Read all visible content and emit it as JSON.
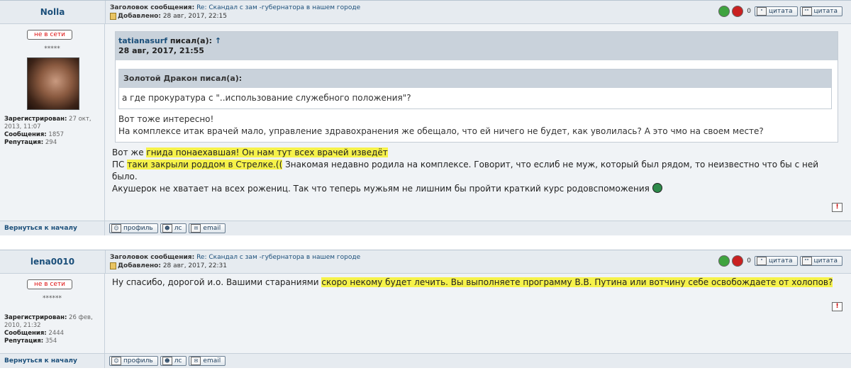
{
  "labels": {
    "subject": "Заголовок сообщения:",
    "added": "Добавлено:",
    "offline": "не в сети",
    "registered": "Зарегистрирован:",
    "messages": "Сообщения:",
    "reputation": "Репутация:",
    "quote_btn": "цитата",
    "profile_btn": "профиль",
    "pm_btn": "лс",
    "email_btn": "email",
    "back_top": "Вернуться к началу",
    "vote_count": "0",
    "report": "!"
  },
  "posts": [
    {
      "author": "Nolla",
      "stars": "*****",
      "subject": "Re: Скандал с зам -губернатора в нашем городе",
      "date": "28 авг, 2017, 22:15",
      "registered": "27 окт, 2013, 11:07",
      "messages": "1857",
      "reputation": "294",
      "quote": {
        "head": "tatianasurf",
        "head_suffix": " писал(а):",
        "arrow": "↑",
        "date": "28 авг, 2017, 21:55",
        "inner_head": "Золотой Дракон писал(а):",
        "inner_text": "а где прокуратура с \"..использование служебного положения\"?",
        "line1": "Вот тоже интересно!",
        "line2": "На комплексе итак врачей мало, управление здравохранения же обещало, что ей ничего не будет, как уволилась? А это чмо на своем месте?"
      },
      "text": {
        "l1a": "Вот же ",
        "l1b": "гнида понаехавшая! Он нам тут всех врачей изведёт",
        "l2a": "ПС ",
        "l2b": "таки закрыли роддом в Стрелке.((",
        "l2c": " Знакомая недавно родила на комплексе. Говорит, что еслиб не муж, который был рядом, то неизвестно что бы с ней было.",
        "l3": "Акушерок не хватает на всех рожениц. Так что теперь мужьям не лишним бы пройти краткий курс родовспоможения "
      }
    },
    {
      "author": "lena0010",
      "stars": "******",
      "subject": "Re: Скандал с зам -губернатора в нашем городе",
      "date": "28 авг, 2017, 22:31",
      "registered": "26 фев, 2010, 21:32",
      "messages": "2444",
      "reputation": "354",
      "text": {
        "a": "Ну спасибо, дорогой и.о. Вашими стараниями ",
        "b": "скоро некому будет лечить. Вы выполняете программу В.В. Путина или вотчину себе освобождаете от холопов?"
      }
    }
  ]
}
